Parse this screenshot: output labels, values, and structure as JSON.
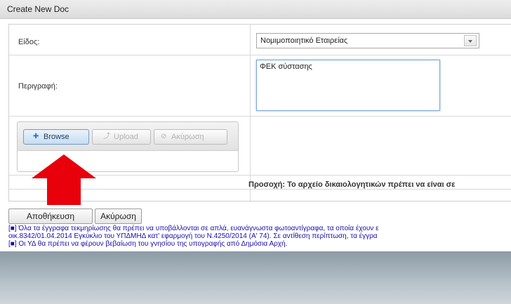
{
  "window": {
    "title": "Create New Doc"
  },
  "form": {
    "type_label": "Είδος:",
    "type_value": "Νομιμοποιητικό Εταιρείας",
    "description_label": "Περιγραφή:",
    "description_value": "ΦΕΚ σύστασης",
    "warning": "Προσοχή: Το αρχείο δικαιολογητικών πρέπει να είναι σε"
  },
  "uploader": {
    "browse_label": "Browse",
    "upload_label": "Upload",
    "cancel_label": "Ακύρωση",
    "browse_icon": "plus-icon",
    "upload_icon": "upload-icon",
    "cancel_icon": "cancel-icon"
  },
  "actions": {
    "save_label": "Αποθήκευση",
    "cancel_label": "Ακύρωση"
  },
  "notes": [
    "[■] Όλα τα έγγραφα τεκμηρίωσης θα πρέπει να υποβάλλονται σε απλά, ευανάγνωστα φωτοαντίγραφα, τα οποία έχουν ε",
    "οικ.8342/01.04.2014 Εγκύκλιο του ΥΠΔΜΗΔ κατ' εφαρμογή του Ν.4250/2014 (Α' 74). Σε αντίθεση περίπτωση, τα έγγρα",
    "[■] Οι ΥΔ θα πρέπει να φέρουν βεβαίωση του γνησίου της υπογραφής από Δημόσια Αρχή."
  ],
  "colors": {
    "accent_arrow": "#e8000b",
    "note_text": "#1a0dab",
    "footer": "#8c9ba6"
  }
}
